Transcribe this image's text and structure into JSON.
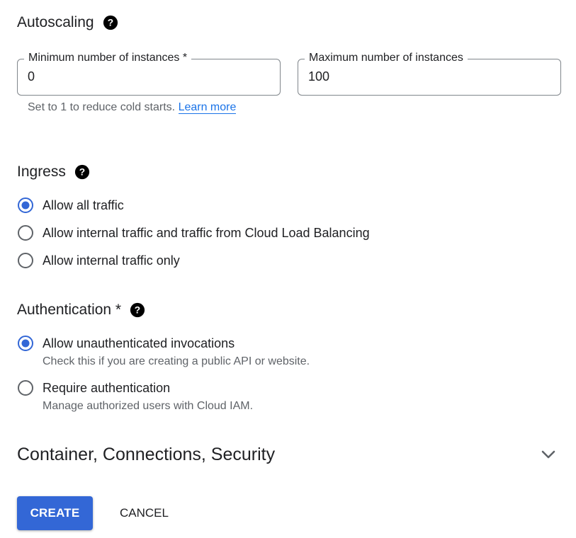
{
  "autoscaling": {
    "title": "Autoscaling",
    "min_field": {
      "label": "Minimum number of instances *",
      "value": "0"
    },
    "max_field": {
      "label": "Maximum number of instances",
      "value": "100"
    },
    "helper_text": "Set to 1 to reduce cold starts. ",
    "learn_more": "Learn more"
  },
  "ingress": {
    "title": "Ingress",
    "options": [
      {
        "label": "Allow all traffic",
        "checked": true
      },
      {
        "label": "Allow internal traffic and traffic from Cloud Load Balancing",
        "checked": false
      },
      {
        "label": "Allow internal traffic only",
        "checked": false
      }
    ]
  },
  "authentication": {
    "title": "Authentication *",
    "options": [
      {
        "label": "Allow unauthenticated invocations",
        "description": "Check this if you are creating a public API or website.",
        "checked": true
      },
      {
        "label": "Require authentication",
        "description": "Manage authorized users with Cloud IAM.",
        "checked": false
      }
    ]
  },
  "advanced": {
    "title": "Container, Connections, Security"
  },
  "actions": {
    "create_label": "CREATE",
    "cancel_label": "CANCEL"
  },
  "colors": {
    "accent": "#3367d6",
    "link": "#1a73e8",
    "text": "#202124",
    "muted": "#5f6368",
    "radio_unchecked": "#5f6368"
  },
  "icons": {
    "help": "help-icon",
    "chevron": "chevron-down-icon"
  }
}
